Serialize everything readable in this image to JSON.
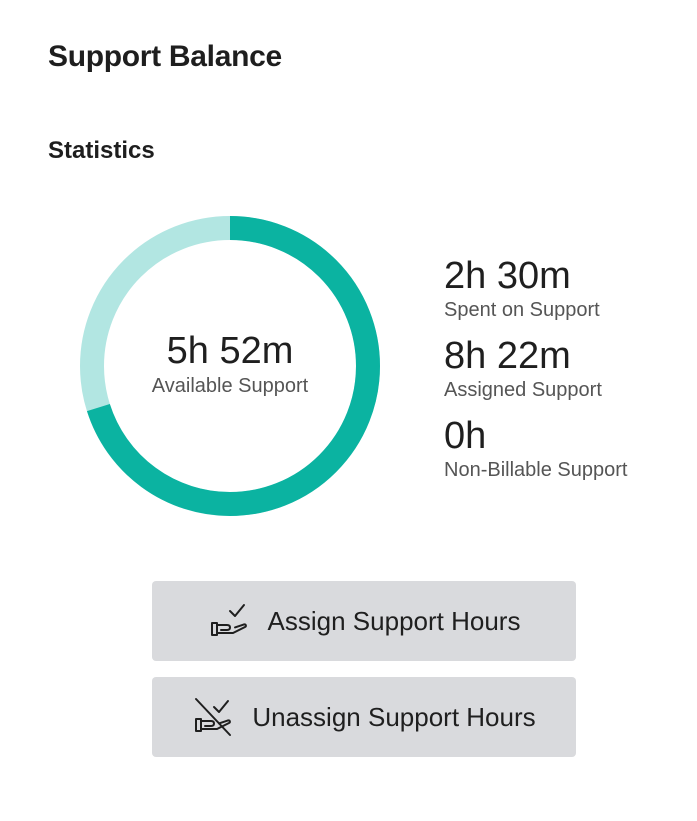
{
  "header": {
    "title": "Support Balance",
    "section_title": "Statistics"
  },
  "donut": {
    "value": "5h 52m",
    "label": "Available Support",
    "spent_fraction": 0.299,
    "available_color": "#0bb3a1",
    "spent_color": "#b2e6e2"
  },
  "stats": [
    {
      "value": "2h 30m",
      "label": "Spent on Support"
    },
    {
      "value": "8h 22m",
      "label": "Assigned Support"
    },
    {
      "value": "0h",
      "label": "Non-Billable Support"
    }
  ],
  "actions": {
    "assign": {
      "label": "Assign Support Hours",
      "icon": "hand-check-icon"
    },
    "unassign": {
      "label": "Unassign Support Hours",
      "icon": "hand-check-crossed-icon"
    }
  }
}
